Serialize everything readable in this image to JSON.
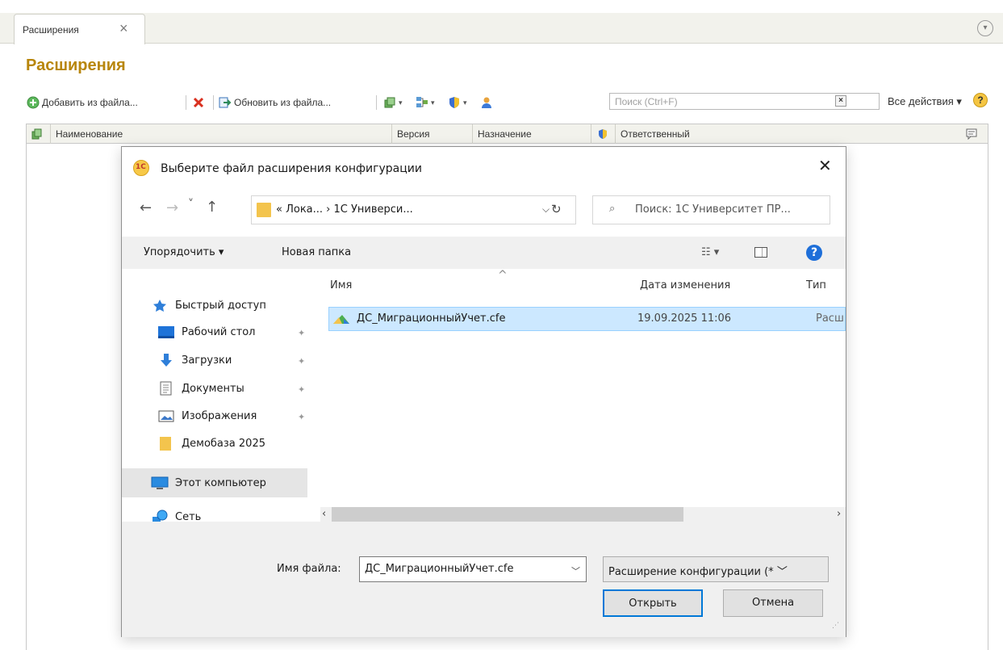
{
  "tab": {
    "label": "Расширения",
    "close": "×"
  },
  "page": {
    "title": "Расширения"
  },
  "toolbar": {
    "add_from_file": "Добавить из файла...",
    "update_from_file": "Обновить из файла...",
    "search_placeholder": "Поиск (Ctrl+F)",
    "search_clear": "×",
    "all_actions": "Все действия ▾",
    "help": "?"
  },
  "grid": {
    "columns": [
      "Наименование",
      "Версия",
      "Назначение",
      "Ответственный"
    ]
  },
  "dialog": {
    "logo": "1С",
    "title": "Выберите файл расширения конфигурации",
    "close": "✕",
    "nav": {
      "back": "←",
      "forward": "→",
      "recent": "˅",
      "up": "↑"
    },
    "address": "« Лока... › 1С Универси...",
    "address_dropdown": "⌵",
    "refresh": "↻",
    "search_icon": "⌕",
    "search_placeholder": "Поиск: 1С Университет ПР...",
    "commands": {
      "organize": "Упорядочить ▾",
      "new_folder": "Новая папка",
      "view": "☷ ▾",
      "help": "?"
    },
    "sidebar": [
      {
        "label": "Быстрый доступ",
        "icon": "star-icon"
      },
      {
        "label": "Рабочий стол",
        "icon": "desktop-icon"
      },
      {
        "label": "Загрузки",
        "icon": "download-icon"
      },
      {
        "label": "Документы",
        "icon": "document-icon"
      },
      {
        "label": "Изображения",
        "icon": "pictures-icon"
      },
      {
        "label": "Демобаза 2025",
        "icon": "folder-icon"
      },
      {
        "label": "Этот компьютер",
        "icon": "computer-icon"
      },
      {
        "label": "Сеть",
        "icon": "network-icon"
      }
    ],
    "pin": "✦",
    "columns": {
      "name": "Имя",
      "date": "Дата изменения",
      "type": "Тип",
      "sort_arrow": "^"
    },
    "files": [
      {
        "name": "ДС_МиграционныйУчет.cfe",
        "date": "19.09.2025 11:06",
        "type": "Расш"
      }
    ],
    "scroll": {
      "left": "‹",
      "right": "›"
    },
    "filename_label": "Имя файла:",
    "filename_value": "ДС_МиграционныйУчет.cfe",
    "filename_dropdown": "﹀",
    "filetype_value": "Расширение конфигурации (* ﹀",
    "open_button": "Открыть",
    "cancel_button": "Отмена"
  },
  "colors": {
    "title_gold": "#b8860b",
    "selection": "#cce8ff",
    "accent": "#0078d7"
  }
}
